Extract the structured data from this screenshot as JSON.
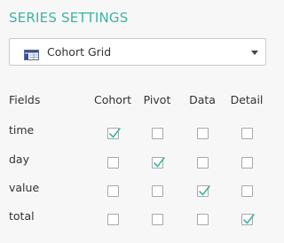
{
  "panel": {
    "title": "SERIES SETTINGS",
    "accent_color": "#3ab5a0"
  },
  "select": {
    "value": "Cohort Grid",
    "icon": "grid-table-icon",
    "caret_icon": "caret-down-icon"
  },
  "table": {
    "fields_header": "Fields",
    "columns": [
      "Cohort",
      "Pivot",
      "Data",
      "Detail"
    ],
    "rows": [
      {
        "label": "time",
        "checked": [
          true,
          false,
          false,
          false
        ]
      },
      {
        "label": "day",
        "checked": [
          false,
          true,
          false,
          false
        ]
      },
      {
        "label": "value",
        "checked": [
          false,
          false,
          true,
          false
        ]
      },
      {
        "label": "total",
        "checked": [
          false,
          false,
          false,
          true
        ]
      }
    ]
  }
}
